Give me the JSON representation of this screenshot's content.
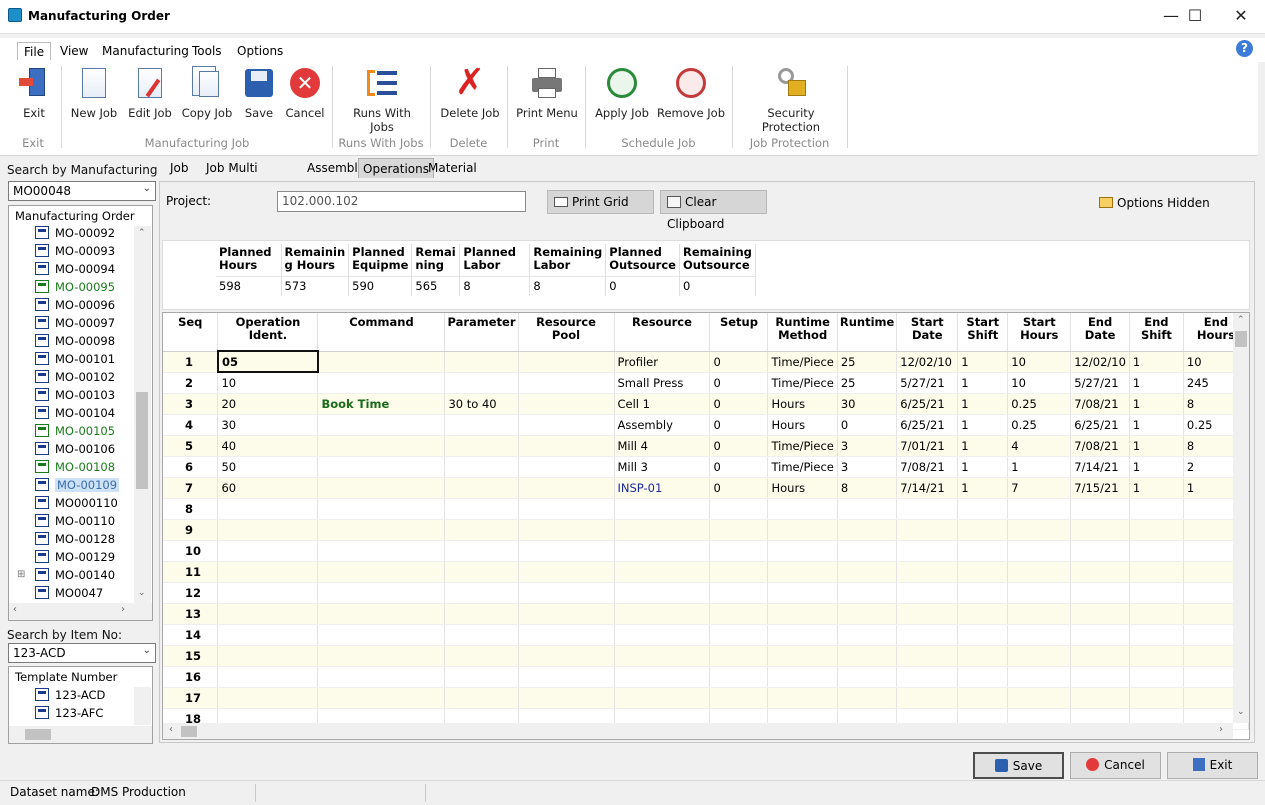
{
  "window": {
    "title": "Manufacturing Order"
  },
  "menu": [
    "File",
    "View",
    "Manufacturing",
    "Tools",
    "Options"
  ],
  "ribbon": {
    "exit": "Exit",
    "new_job": "New Job",
    "edit_job": "Edit Job",
    "copy_job": "Copy Job",
    "save": "Save",
    "cancel": "Cancel",
    "runs_with_jobs": "Runs With Jobs",
    "delete_job": "Delete Job",
    "print_menu": "Print Menu",
    "apply_job": "Apply Job",
    "remove_job": "Remove Job",
    "security_protection": "Security Protection",
    "groups": {
      "exit": "Exit",
      "manufacturing_job": "Manufacturing Job",
      "runs_with_jobs": "Runs With Jobs",
      "delete": "Delete",
      "print": "Print",
      "schedule_job": "Schedule Job",
      "job_protection": "Job Protection"
    }
  },
  "left": {
    "search_mo_label": "Search by Manufacturing Orde",
    "search_mo_value": "MO00048",
    "mo_tree_header": "Manufacturing Order",
    "mo_items": [
      {
        "label": "MO-00092",
        "state": ""
      },
      {
        "label": "MO-00093",
        "state": ""
      },
      {
        "label": "MO-00094",
        "state": ""
      },
      {
        "label": "MO-00095",
        "state": "green"
      },
      {
        "label": "MO-00096",
        "state": ""
      },
      {
        "label": "MO-00097",
        "state": ""
      },
      {
        "label": "MO-00098",
        "state": ""
      },
      {
        "label": "MO-00101",
        "state": ""
      },
      {
        "label": "MO-00102",
        "state": ""
      },
      {
        "label": "MO-00103",
        "state": ""
      },
      {
        "label": "MO-00104",
        "state": ""
      },
      {
        "label": "MO-00105",
        "state": "green"
      },
      {
        "label": "MO-00106",
        "state": ""
      },
      {
        "label": "MO-00108",
        "state": "green"
      },
      {
        "label": "MO-00109",
        "state": "selected"
      },
      {
        "label": "MO000110",
        "state": ""
      },
      {
        "label": "MO-00110",
        "state": ""
      },
      {
        "label": "MO-00128",
        "state": ""
      },
      {
        "label": "MO-00129",
        "state": ""
      },
      {
        "label": "MO-00140",
        "state": "expandable"
      },
      {
        "label": "MO0047",
        "state": ""
      }
    ],
    "search_item_label": "Search by Item No:",
    "search_item_value": "123-ACD",
    "template_header": "Template Number",
    "templates": [
      "123-ACD",
      "123-AFC"
    ]
  },
  "tabs": [
    "Job",
    "Job Multi Template",
    "Assembly",
    "Operations",
    "Material"
  ],
  "active_tab": "Operations",
  "operations": {
    "project_label": "Project:",
    "project_value": "102.000.102",
    "print_grid": "Print Grid",
    "clear_clipboard": "Clear Clipboard",
    "options_hidden": "Options Hidden",
    "summary_headers": [
      "Planned Hours",
      "Remaining Hours",
      "Planned Equipment",
      "Remaining",
      "Planned Labor",
      "Remaining Labor",
      "Planned Outsource",
      "Remaining Outsource"
    ],
    "summary_headers_display": [
      [
        "Planned",
        "Hours"
      ],
      [
        "Remainin",
        "g Hours"
      ],
      [
        "Planned",
        "Equipme"
      ],
      [
        "Remai",
        "ning"
      ],
      [
        "Planned",
        "Labor"
      ],
      [
        "Remaining",
        "Labor"
      ],
      [
        "Planned",
        "Outsource"
      ],
      [
        "Remaining",
        "Outsource"
      ]
    ],
    "summary_values": [
      "598",
      "573",
      "590",
      "565",
      "8",
      "8",
      "0",
      "0"
    ],
    "grid_headers": [
      [
        "Seq"
      ],
      [
        "Operation Ident."
      ],
      [
        "Command"
      ],
      [
        "Parameter"
      ],
      [
        "Resource Pool"
      ],
      [
        "Resource"
      ],
      [
        "Setup"
      ],
      [
        "Runtime",
        "Method"
      ],
      [
        "Runtime"
      ],
      [
        "Start",
        "Date"
      ],
      [
        "Start",
        "Shift"
      ],
      [
        "Start",
        "Hours"
      ],
      [
        "End",
        "Date"
      ],
      [
        "End",
        "Shift"
      ],
      [
        "End Hours"
      ]
    ],
    "rows": [
      [
        "1",
        "05",
        "",
        "",
        "",
        "Profiler",
        "0",
        "Time/Piece",
        "25",
        "12/02/10",
        "1",
        "10",
        "12/02/10",
        "1",
        "10"
      ],
      [
        "2",
        "10",
        "",
        "",
        "",
        "Small Press",
        "0",
        "Time/Piece",
        "25",
        "5/27/21",
        "1",
        "10",
        "5/27/21",
        "1",
        "245"
      ],
      [
        "3",
        "20",
        "Book Time",
        "30 to 40",
        "",
        "Cell 1",
        "0",
        "Hours",
        "30",
        "6/25/21",
        "1",
        "0.25",
        "7/08/21",
        "1",
        "8"
      ],
      [
        "4",
        "30",
        "",
        "",
        "",
        "Assembly",
        "0",
        "Hours",
        "0",
        "6/25/21",
        "1",
        "0.25",
        "6/25/21",
        "1",
        "0.25"
      ],
      [
        "5",
        "40",
        "",
        "",
        "",
        "Mill 4",
        "0",
        "Time/Piece",
        "3",
        "7/01/21",
        "1",
        "4",
        "7/08/21",
        "1",
        "8"
      ],
      [
        "6",
        "50",
        "",
        "",
        "",
        "Mill 3",
        "0",
        "Time/Piece",
        "3",
        "7/08/21",
        "1",
        "1",
        "7/14/21",
        "1",
        "2"
      ],
      [
        "7",
        "60",
        "",
        "",
        "",
        "INSP-01",
        "0",
        "Hours",
        "8",
        "7/14/21",
        "1",
        "7",
        "7/15/21",
        "1",
        "1"
      ],
      [
        "8",
        "",
        "",
        "",
        "",
        "",
        "",
        "",
        "",
        "",
        "",
        "",
        "",
        "",
        ""
      ],
      [
        "9",
        "",
        "",
        "",
        "",
        "",
        "",
        "",
        "",
        "",
        "",
        "",
        "",
        "",
        ""
      ],
      [
        "10",
        "",
        "",
        "",
        "",
        "",
        "",
        "",
        "",
        "",
        "",
        "",
        "",
        "",
        ""
      ],
      [
        "11",
        "",
        "",
        "",
        "",
        "",
        "",
        "",
        "",
        "",
        "",
        "",
        "",
        "",
        ""
      ],
      [
        "12",
        "",
        "",
        "",
        "",
        "",
        "",
        "",
        "",
        "",
        "",
        "",
        "",
        "",
        ""
      ],
      [
        "13",
        "",
        "",
        "",
        "",
        "",
        "",
        "",
        "",
        "",
        "",
        "",
        "",
        "",
        ""
      ],
      [
        "14",
        "",
        "",
        "",
        "",
        "",
        "",
        "",
        "",
        "",
        "",
        "",
        "",
        "",
        ""
      ],
      [
        "15",
        "",
        "",
        "",
        "",
        "",
        "",
        "",
        "",
        "",
        "",
        "",
        "",
        "",
        ""
      ],
      [
        "16",
        "",
        "",
        "",
        "",
        "",
        "",
        "",
        "",
        "",
        "",
        "",
        "",
        "",
        ""
      ],
      [
        "17",
        "",
        "",
        "",
        "",
        "",
        "",
        "",
        "",
        "",
        "",
        "",
        "",
        "",
        ""
      ],
      [
        "18",
        "",
        "",
        "",
        "",
        "",
        "",
        "",
        "",
        "",
        "",
        "",
        "",
        "",
        ""
      ]
    ]
  },
  "footer": {
    "save": "Save",
    "cancel": "Cancel",
    "exit": "Exit"
  },
  "status": {
    "dataset_label": "Dataset name:",
    "dataset_value": "DMS Production"
  },
  "colors": {
    "accent": "#1e90c9",
    "command_green": "#1a6b1a",
    "tree_green": "#1a7a1a",
    "row_stripe": "#fdfbea"
  }
}
